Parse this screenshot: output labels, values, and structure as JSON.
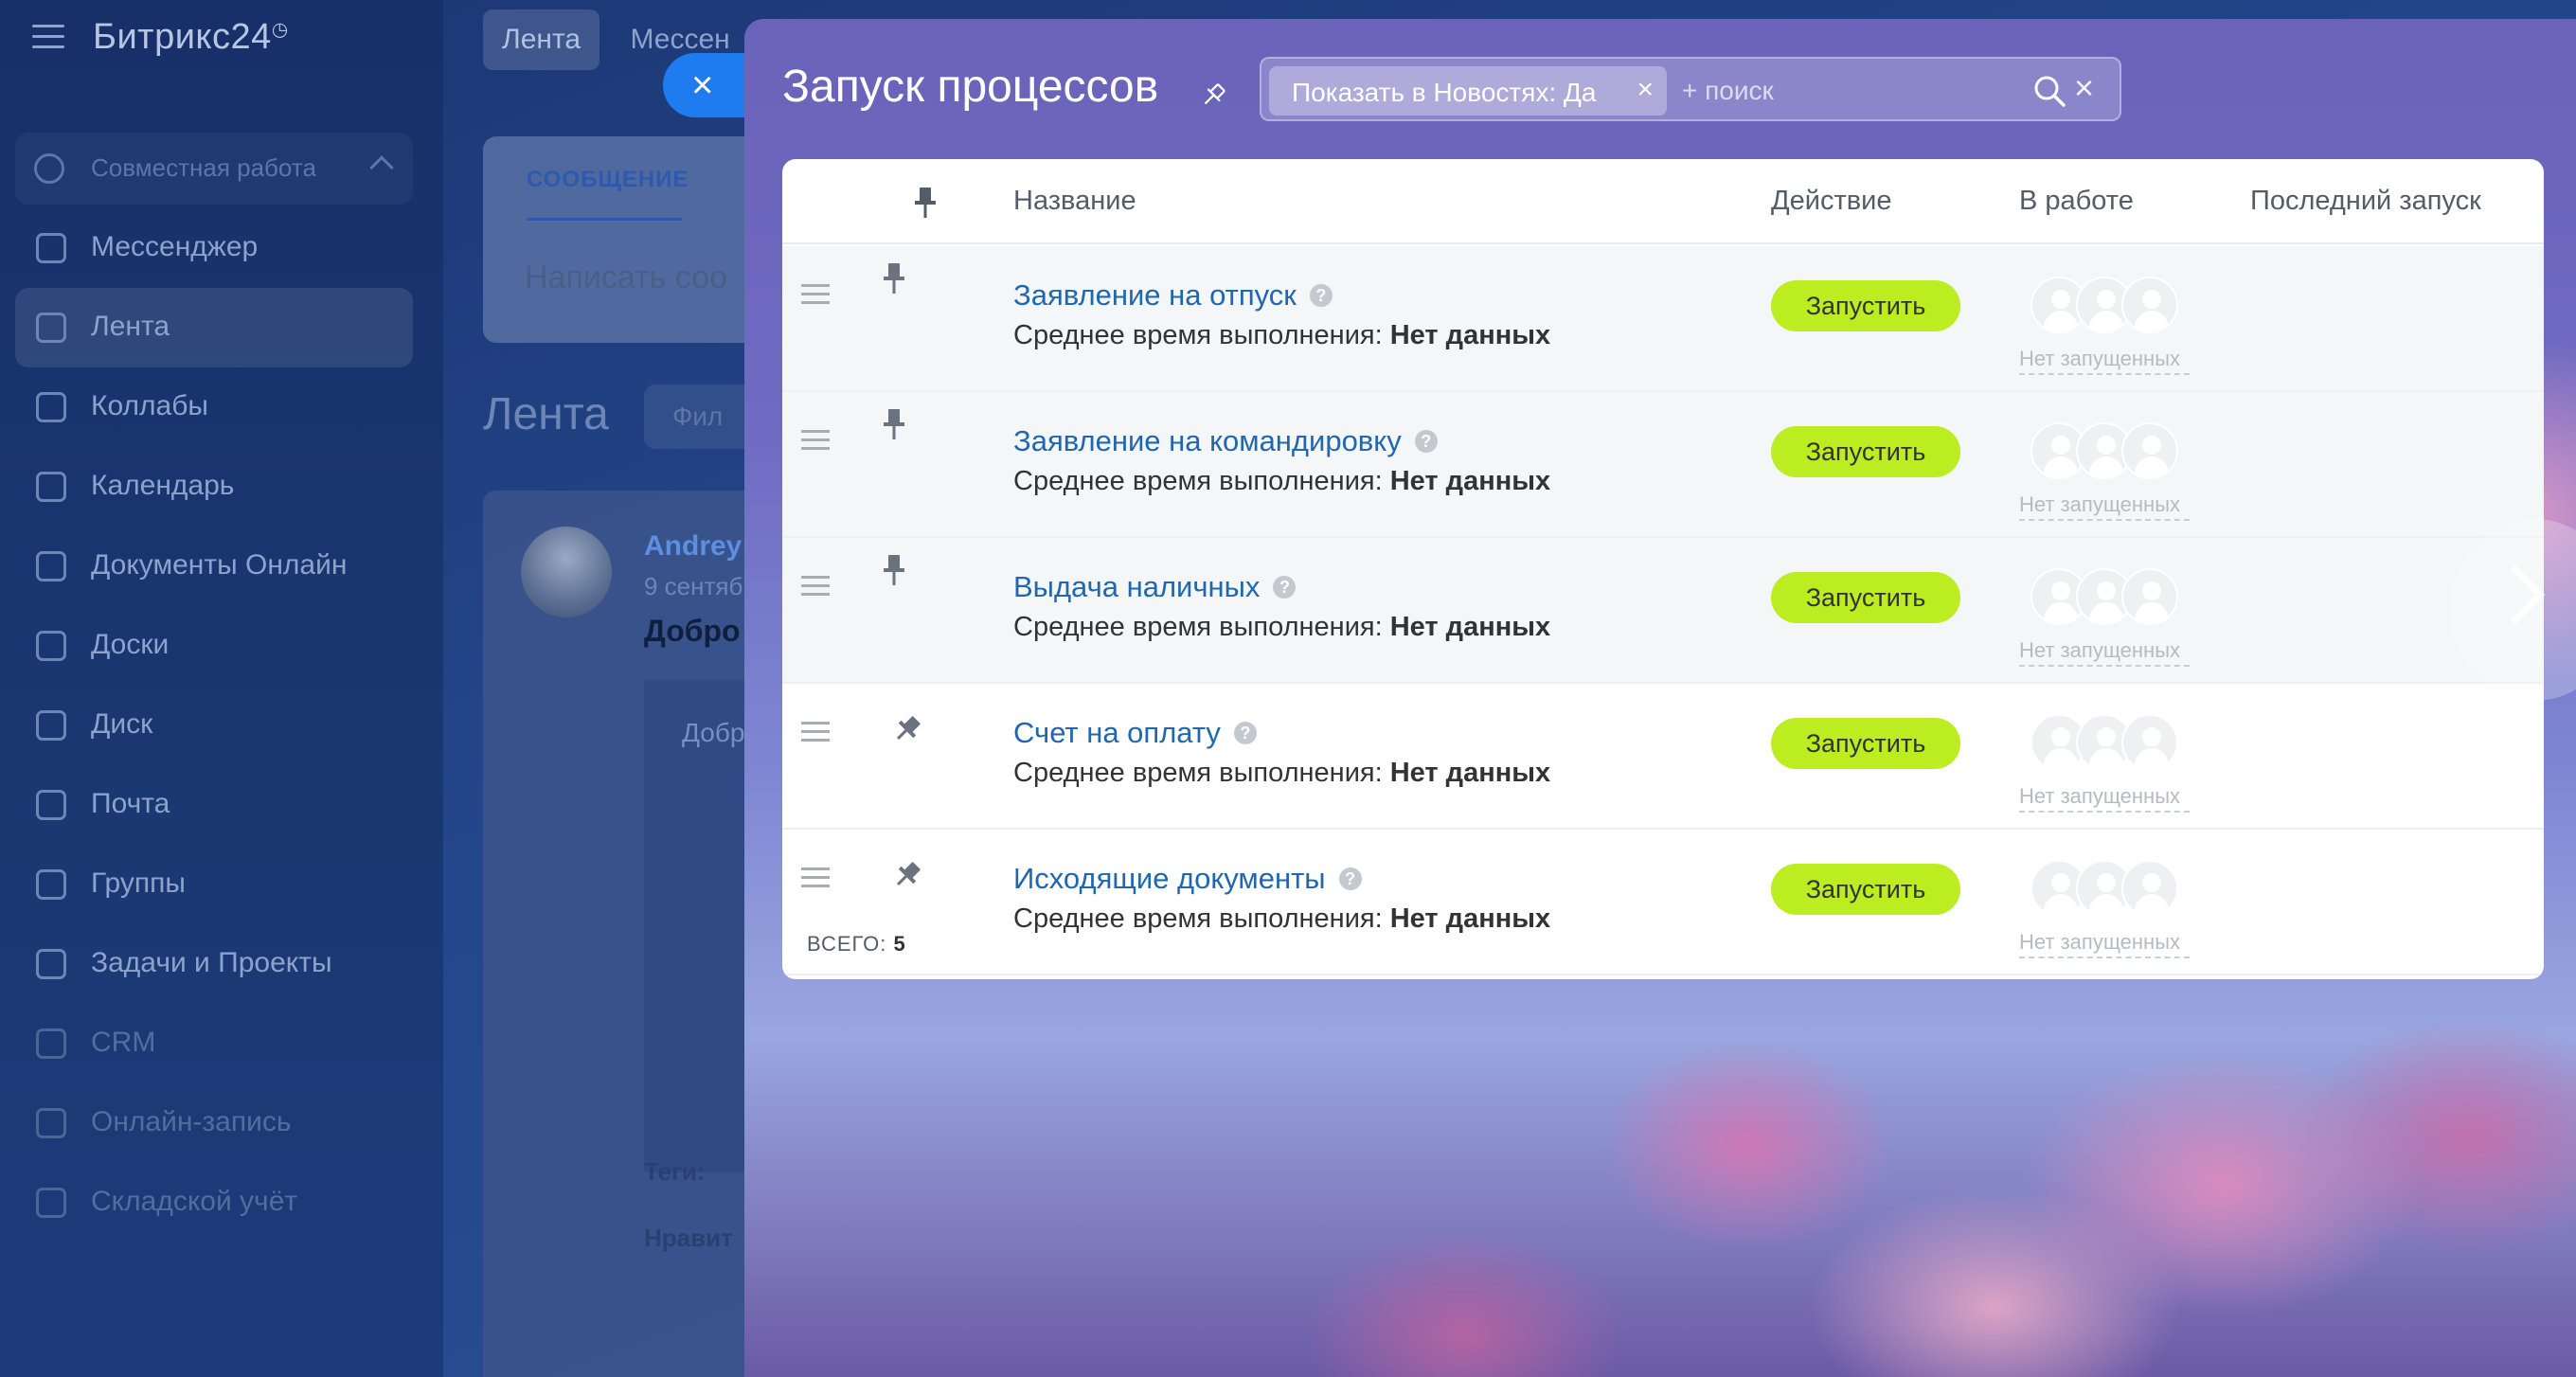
{
  "app": {
    "brand": "Битрикс24",
    "section": "Совместная работа",
    "nav": [
      {
        "label": "Мессенджер",
        "icon": "chat-icon",
        "active": false,
        "dim": false
      },
      {
        "label": "Лента",
        "icon": "feed-icon",
        "active": true,
        "dim": false
      },
      {
        "label": "Коллабы",
        "icon": "collab-icon",
        "active": false,
        "dim": false
      },
      {
        "label": "Календарь",
        "icon": "calendar-icon",
        "active": false,
        "dim": false
      },
      {
        "label": "Документы Онлайн",
        "icon": "document-icon",
        "active": false,
        "dim": false
      },
      {
        "label": "Доски",
        "icon": "board-icon",
        "active": false,
        "dim": false
      },
      {
        "label": "Диск",
        "icon": "disk-icon",
        "active": false,
        "dim": false
      },
      {
        "label": "Почта",
        "icon": "mail-icon",
        "active": false,
        "dim": false
      },
      {
        "label": "Группы",
        "icon": "groups-icon",
        "active": false,
        "dim": false
      },
      {
        "label": "Задачи и Проекты",
        "icon": "tasks-icon",
        "active": false,
        "dim": false
      },
      {
        "label": "CRM",
        "icon": "crm-icon",
        "active": false,
        "dim": true
      },
      {
        "label": "Онлайн-запись",
        "icon": "booking-icon",
        "active": false,
        "dim": true
      },
      {
        "label": "Складской учёт",
        "icon": "warehouse-icon",
        "active": false,
        "dim": true
      }
    ],
    "top_tabs": [
      "Лента",
      "Мессен"
    ],
    "compose": {
      "tab": "СООБЩЕНИЕ",
      "placeholder": "Написать соо"
    },
    "feed": {
      "title": "Лента",
      "filter": "Фил",
      "post": {
        "author": "Andrey",
        "date": "9 сентяб",
        "headline": "Добро",
        "image_text": "Добр",
        "tags": "Теги:",
        "like": "Нравит"
      }
    }
  },
  "slider": {
    "close_label": "×",
    "title": "Запуск процессов",
    "filter_chip": "Показать в Новостях: Да",
    "chip_remove": "×",
    "search_placeholder": "+ поиск",
    "clear_label": "×",
    "columns": {
      "name": "Название",
      "action": "Действие",
      "in_work": "В работе",
      "last_run": "Последний запуск"
    },
    "rows": [
      {
        "name": "Заявление на отпуск",
        "avg_label": "Среднее время выполнения:",
        "avg_value": "Нет данных",
        "action": "Запустить",
        "not_running": "Нет запущенных",
        "pinned": true
      },
      {
        "name": "Заявление на командировку",
        "avg_label": "Среднее время выполнения:",
        "avg_value": "Нет данных",
        "action": "Запустить",
        "not_running": "Нет запущенных",
        "pinned": true
      },
      {
        "name": "Выдача наличных",
        "avg_label": "Среднее время выполнения:",
        "avg_value": "Нет данных",
        "action": "Запустить",
        "not_running": "Нет запущенных",
        "pinned": true
      },
      {
        "name": "Счет на оплату",
        "avg_label": "Среднее время выполнения:",
        "avg_value": "Нет данных",
        "action": "Запустить",
        "not_running": "Нет запущенных",
        "pinned": false
      },
      {
        "name": "Исходящие документы",
        "avg_label": "Среднее время выполнения:",
        "avg_value": "Нет данных",
        "action": "Запустить",
        "not_running": "Нет запущенных",
        "pinned": false
      }
    ],
    "total_label": "ВСЕГО:",
    "total_value": "5",
    "colors": {
      "accent": "#bbed21",
      "link": "#2067b0"
    }
  }
}
